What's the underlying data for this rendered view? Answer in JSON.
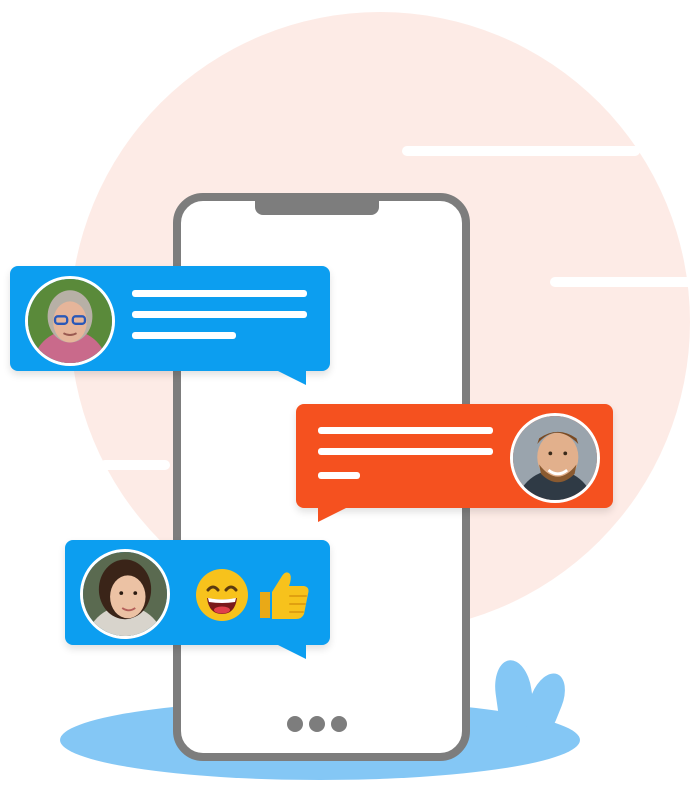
{
  "illustration": {
    "colors": {
      "background_circle": "#fdebe6",
      "ground": "#84c7f5",
      "phone_frame": "#7d7d7d",
      "bubble_blue": "#0c9ef0",
      "bubble_orange": "#f5511f",
      "text_placeholder": "#ffffff"
    },
    "messages": [
      {
        "sender": "older-woman-avatar",
        "bubble_color": "blue",
        "content": "text-placeholder-lines",
        "line_count": 3
      },
      {
        "sender": "bearded-man-avatar",
        "bubble_color": "orange",
        "content": "text-placeholder-lines",
        "line_count": 3
      },
      {
        "sender": "young-woman-avatar",
        "bubble_color": "blue",
        "content": "emoji-reactions",
        "emojis": [
          "grinning-face-icon",
          "thumbs-up-icon"
        ]
      }
    ],
    "phone": {
      "home_indicator_dots": 3
    }
  }
}
